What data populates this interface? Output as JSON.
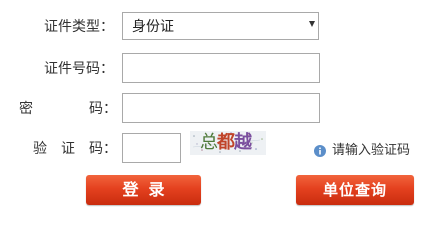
{
  "form": {
    "cert_type_label": "证件类型：",
    "cert_type_selected": "身份证",
    "cert_number_label": "证件号码：",
    "cert_number_value": "",
    "password_label_a": "密",
    "password_label_b": "码：",
    "password_value": "",
    "captcha_label_a": "验",
    "captcha_label_b": "证",
    "captcha_label_c": "码：",
    "captcha_value": "",
    "captcha_chars": [
      "总",
      "都",
      "越"
    ],
    "captcha_hint": "请输入验证码"
  },
  "buttons": {
    "login": "登录",
    "unit_query": "单位查询"
  },
  "colors": {
    "button_red": "#e4411f",
    "info_icon_blue": "#5b8ec9"
  },
  "icons": {
    "select_arrow": "chevron-down-icon",
    "hint": "info-icon"
  }
}
